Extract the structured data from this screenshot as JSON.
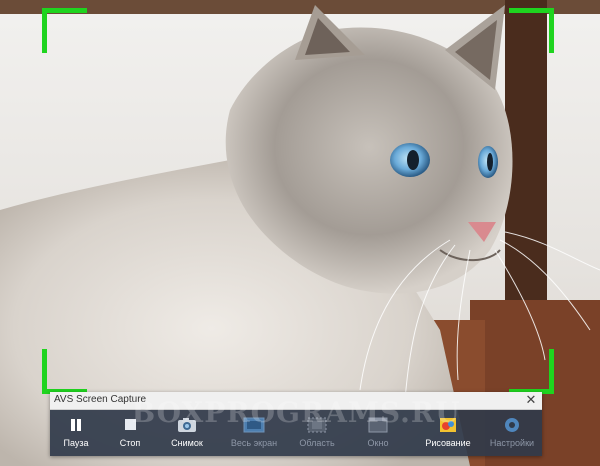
{
  "toolbar": {
    "title": "AVS Screen Capture",
    "close_glyph": "✕",
    "buttons": [
      {
        "label": "Пауза",
        "icon": "pause-icon",
        "enabled": true
      },
      {
        "label": "Стоп",
        "icon": "stop-icon",
        "enabled": true
      },
      {
        "label": "Снимок",
        "icon": "camera-icon",
        "enabled": true
      },
      {
        "label": "Весь экран",
        "icon": "fullscreen-icon",
        "enabled": false
      },
      {
        "label": "Область",
        "icon": "region-icon",
        "enabled": false
      },
      {
        "label": "Окно",
        "icon": "window-icon",
        "enabled": false
      },
      {
        "label": "Рисование",
        "icon": "drawing-icon",
        "enabled": true
      },
      {
        "label": "Настройки",
        "icon": "settings-gear-icon",
        "enabled": false
      }
    ]
  },
  "watermark": "BOXPROGRAMS.RU",
  "colors": {
    "capture_corners": "#1fd41f",
    "toolbar_bg": "#303a4a"
  }
}
